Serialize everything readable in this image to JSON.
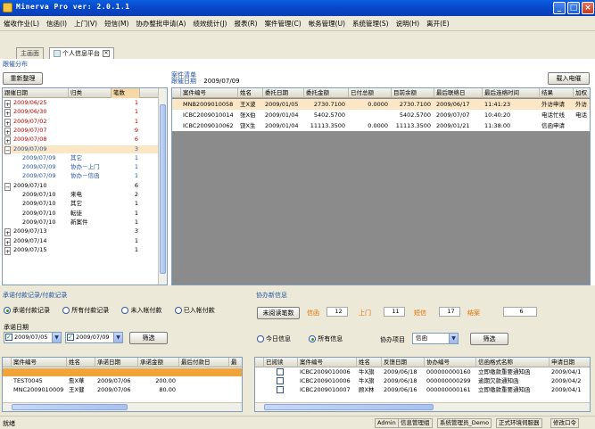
{
  "window": {
    "title": "Minerva Pro ver: 2.0.1.1"
  },
  "menu": [
    "催收作业(L)",
    "信函(I)",
    "上门(V)",
    "短信(M)",
    "协办整批申请(A)",
    "绩效统计(J)",
    "报表(R)",
    "案件管理(C)",
    "帐务管理(U)",
    "系统管理(S)",
    "说明(H)",
    "离开(E)"
  ],
  "tabs": {
    "home": "主画面",
    "personal": "个人信息平台"
  },
  "left": {
    "section_title": "跟催分布",
    "refresh_label": "重新整理",
    "columns": [
      "跟催日期",
      "归类",
      "笔数"
    ],
    "rows": [
      {
        "date": "2009/06/25",
        "type": "",
        "count": "1",
        "color": "#c00000",
        "exp": "+"
      },
      {
        "date": "2009/06/30",
        "type": "",
        "count": "1",
        "color": "#c00000",
        "exp": "+"
      },
      {
        "date": "2009/07/02",
        "type": "",
        "count": "1",
        "color": "#c00000",
        "exp": "+"
      },
      {
        "date": "2009/07/07",
        "type": "",
        "count": "9",
        "color": "#c00000",
        "exp": "+"
      },
      {
        "date": "2009/07/08",
        "type": "",
        "count": "6",
        "color": "#c00000",
        "exp": "+"
      },
      {
        "date": "2009/07/09",
        "type": "",
        "count": "3",
        "color": "#2456a6",
        "exp": "−"
      },
      {
        "date": "2009/07/09",
        "type": "其它",
        "count": "1",
        "color": "#2456a6",
        "exp": ""
      },
      {
        "date": "2009/07/09",
        "type": "协办－上门",
        "count": "1",
        "color": "#2456a6",
        "exp": ""
      },
      {
        "date": "2009/07/09",
        "type": "协办－信函",
        "count": "1",
        "color": "#2456a6",
        "exp": ""
      },
      {
        "date": "2009/07/10",
        "type": "",
        "count": "6",
        "color": "#000000",
        "exp": "−"
      },
      {
        "date": "2009/07/10",
        "type": "来电",
        "count": "2",
        "color": "#000000",
        "exp": ""
      },
      {
        "date": "2009/07/10",
        "type": "其它",
        "count": "1",
        "color": "#000000",
        "exp": ""
      },
      {
        "date": "2009/07/10",
        "type": "転徒",
        "count": "1",
        "color": "#000000",
        "exp": ""
      },
      {
        "date": "2009/07/10",
        "type": "新案件",
        "count": "1",
        "color": "#000000",
        "exp": ""
      },
      {
        "date": "2009/07/13",
        "type": "",
        "count": "3",
        "color": "#000000",
        "exp": "+"
      },
      {
        "date": "2009/07/14",
        "type": "",
        "count": "1",
        "color": "#000000",
        "exp": "+"
      },
      {
        "date": "2009/07/15",
        "type": "",
        "count": "1",
        "color": "#000000",
        "exp": "+"
      }
    ]
  },
  "cases": {
    "section_title": "案件清单",
    "date_label": "跟催日期",
    "date_value": "2009/07/09",
    "load_label": "载入电催",
    "columns": [
      "案件编号",
      "姓名",
      "委托日期",
      "委托金额",
      "已付总额",
      "目前余额",
      "最后联络日",
      "最后连络时间",
      "结果",
      "加权"
    ],
    "rows": [
      [
        "MNB2009010058",
        "王X波",
        "2009/01/05",
        "2730.7100",
        "0.0000",
        "2730.7100",
        "2009/06/17",
        "11:41:23",
        "外访申请",
        "外访"
      ],
      [
        "ICBC2009010014",
        "张X伯",
        "2009/01/04",
        "5402.5700",
        "",
        "5402.5700",
        "2009/07/07",
        "10:40:20",
        "电话忙线",
        "电话"
      ],
      [
        "ICBC2009010062",
        "饶X生",
        "2009/01/04",
        "11113.3500",
        "0.0000",
        "11113.3500",
        "2009/01/21",
        "11:38:00",
        "信函申请",
        ""
      ]
    ]
  },
  "payments": {
    "section_title": "承诺付款记录/付款记录",
    "radios": [
      "承诺付款记录",
      "所有付款记录",
      "未入帐付款",
      "已入帐付款"
    ],
    "date_label": "承诺日期",
    "date_from": "2009/07/05",
    "date_to": "2009/07/09",
    "filter_label": "筛选",
    "columns": [
      "案件编号",
      "姓名",
      "承诺日期",
      "承诺金额",
      "最后付款日",
      "最"
    ],
    "rows": [
      [
        "",
        "",
        "",
        "",
        "",
        ""
      ],
      [
        "TEST0045",
        "詹X華",
        "2009/07/06",
        "200.00",
        "",
        ""
      ],
      [
        "MNC2009010009",
        "王X健",
        "2009/07/06",
        "80.00",
        "",
        ""
      ]
    ]
  },
  "messages": {
    "section_title": "协办新信息",
    "unread_label": "未阅读笔数",
    "counts": [
      {
        "label": "信函",
        "value": "12"
      },
      {
        "label": "上门",
        "value": "11"
      },
      {
        "label": "短信",
        "value": "17"
      },
      {
        "label": "结案",
        "value": "6"
      }
    ],
    "radios": [
      "今日信息",
      "所有信息"
    ],
    "project_label": "协办项目",
    "project_value": "信函",
    "filter_label": "筛选",
    "columns": [
      "已阅读",
      "案件编号",
      "姓名",
      "反馈日期",
      "协办编号",
      "信函格式名称",
      "申请日期"
    ],
    "rows": [
      [
        "",
        "ICBC2009010006",
        "牛X旗",
        "2009/06/18",
        "000000000160",
        "立即缴款重要通知函",
        "2009/04/1"
      ],
      [
        "",
        "ICBC2009010006",
        "牛X旗",
        "2009/06/18",
        "000000000299",
        "逾期欠款通知函",
        "2009/04/2"
      ],
      [
        "",
        "ICBC2009010007",
        "顾X林",
        "2009/06/16",
        "000000000161",
        "立即缴款重要通知函",
        "2009/04/1"
      ]
    ]
  },
  "status": {
    "left": "就绪",
    "user": "Admin",
    "group": "信息管理组",
    "admin": "系统管理员_Demo",
    "server": "正式环境伺服器",
    "password": "修改口令"
  }
}
